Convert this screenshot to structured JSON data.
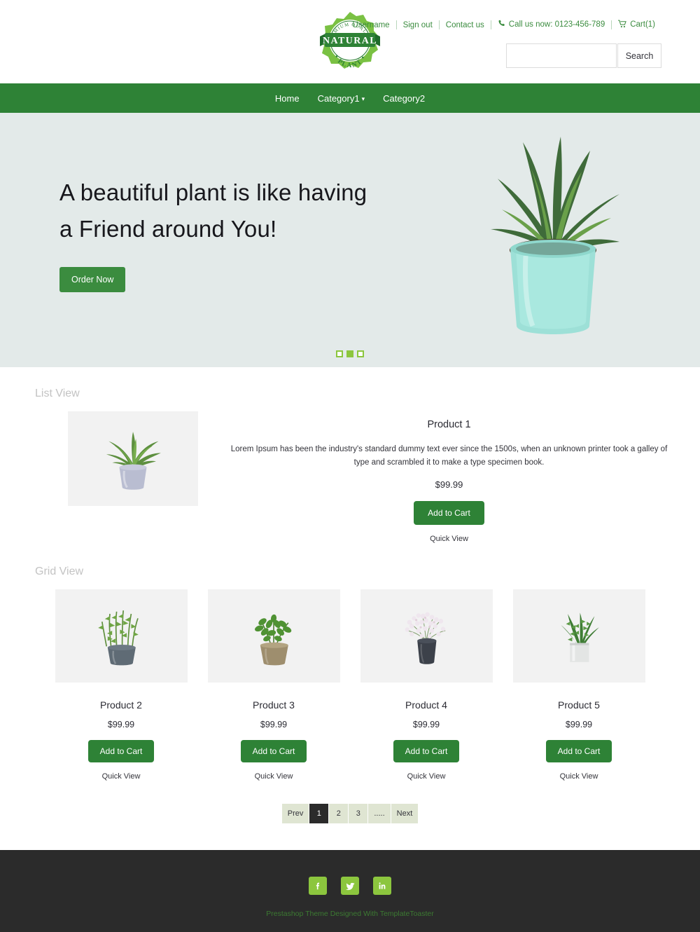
{
  "header": {
    "logo": {
      "top_text": "PREMIUM QUALITY",
      "main_text": "NATURAL",
      "bottom_text": "PLANT"
    },
    "utility": {
      "username": "Username",
      "sign_out": "Sign out",
      "contact": "Contact us",
      "phone": "Call us now: 0123-456-789",
      "cart": "Cart(1)",
      "phone_icon": "phone-icon",
      "cart_icon": "cart-icon",
      "link_color": "#3b8c3f"
    },
    "search": {
      "value": "",
      "placeholder": "",
      "button_label": "Search"
    }
  },
  "nav": {
    "background": "#2e8236",
    "items": [
      {
        "label": "Home",
        "has_dropdown": false
      },
      {
        "label": "Category1",
        "has_dropdown": true
      },
      {
        "label": "Category2",
        "has_dropdown": false
      }
    ]
  },
  "hero": {
    "background": "#e3eae9",
    "title_line1": "A beautiful plant is like having",
    "title_line2": "a Friend around You!",
    "button_label": "Order Now",
    "button_color": "#3b8c3f",
    "image_alt": "haworthia-succulent-in-mint-pot",
    "carousel": {
      "total": 3,
      "active_index": 1,
      "color": "#8cc63e"
    }
  },
  "list_view": {
    "section_label": "List View",
    "product": {
      "name": "Product 1",
      "description": "Lorem Ipsum has been the industry's standard dummy text ever since the 1500s, when an unknown printer took a galley of type and scrambled it to make a type specimen book.",
      "price": "$99.99",
      "cart_label": "Add to Cart",
      "quick_label": "Quick View",
      "image_alt": "bushy-green-plant-in-lavender-pot"
    }
  },
  "grid_view": {
    "section_label": "Grid View",
    "cart_label": "Add to Cart",
    "quick_label": "Quick View",
    "products": [
      {
        "name": "Product 2",
        "price": "$99.99",
        "image_alt": "rosemary-plant-in-slate-pot"
      },
      {
        "name": "Product 3",
        "price": "$99.99",
        "image_alt": "zz-plant-in-tan-pot"
      },
      {
        "name": "Product 4",
        "price": "$99.99",
        "image_alt": "white-flowering-plant-in-dark-pot"
      },
      {
        "name": "Product 5",
        "price": "$99.99",
        "image_alt": "zz-plant-in-white-cube-pot"
      }
    ]
  },
  "pagination": {
    "prev_label": "Prev",
    "next_label": "Next",
    "pages": [
      "1",
      "2",
      "3",
      "....."
    ],
    "active_page": "1",
    "active_color": "#2b2b2b",
    "idle_color": "#dfe5d2"
  },
  "footer": {
    "background": "#2b2b2b",
    "socials": [
      {
        "name": "facebook-icon",
        "glyph": "f"
      },
      {
        "name": "twitter-icon",
        "glyph": "t"
      },
      {
        "name": "linkedin-icon",
        "glyph": "in"
      }
    ],
    "credit": "Prestashop Theme Designed With TemplateToaster",
    "credit_color": "#3c7a32"
  }
}
